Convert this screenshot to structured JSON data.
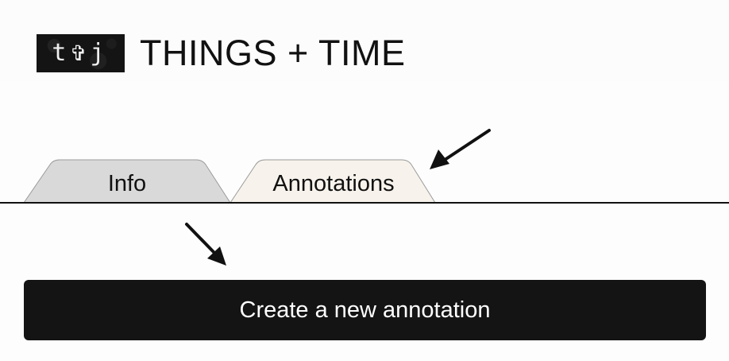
{
  "header": {
    "logo_glyphs": "t✞j",
    "title": "THINGS + TIME"
  },
  "tabs": [
    {
      "label": "Info",
      "active": false,
      "fill": "#d9d9d9"
    },
    {
      "label": "Annotations",
      "active": true,
      "fill": "#f7f3ec"
    }
  ],
  "actions": {
    "create_label": "Create a new annotation"
  },
  "annotations": [
    {
      "kind": "arrow",
      "icon": "arrow-down-left-icon",
      "points_to": "Annotations tab"
    },
    {
      "kind": "arrow",
      "icon": "arrow-down-right-icon",
      "points_to": "Create a new annotation button"
    }
  ],
  "colors": {
    "background": "#fdfdfd",
    "text": "#111111",
    "button_bg": "#141414",
    "button_text": "#ffffff",
    "tab_inactive": "#d9d9d9",
    "tab_active": "#f7f3ec"
  }
}
